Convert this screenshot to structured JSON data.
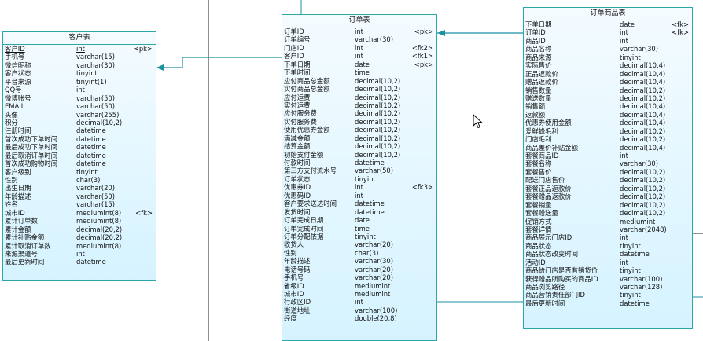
{
  "entities": {
    "customer": {
      "title": "客户表",
      "rows": [
        [
          "客户ID",
          "int",
          "<pk>"
        ],
        [
          "手机号",
          "varchar(15)",
          ""
        ],
        [
          "微信昵称",
          "varchar(30)",
          ""
        ],
        [
          "客户状态",
          "tinyint",
          ""
        ],
        [
          "平台来源",
          "tinyint(1)",
          ""
        ],
        [
          "QQ号",
          "int",
          ""
        ],
        [
          "微博账号",
          "varchar(50)",
          ""
        ],
        [
          "EMAIL",
          "varchar(50)",
          ""
        ],
        [
          "头像",
          "varchar(255)",
          ""
        ],
        [
          "积分",
          "decimal(10,2)",
          ""
        ],
        [
          "注册时间",
          "datetime",
          ""
        ],
        [
          "首次成功下单时间",
          "datetime",
          ""
        ],
        [
          "最后成功下单时间",
          "datetime",
          ""
        ],
        [
          "最后取消订单时间",
          "datetime",
          ""
        ],
        [
          "首次成功购物时间",
          "datetime",
          ""
        ],
        [
          "客户级别",
          "tinyint",
          ""
        ],
        [
          "性别",
          "char(3)",
          ""
        ],
        [
          "出生日期",
          "varchar(20)",
          ""
        ],
        [
          "年龄描述",
          "varchar(50)",
          ""
        ],
        [
          "姓名",
          "varchar(15)",
          ""
        ],
        [
          "城市ID",
          "mediumint(8)",
          "<fk>"
        ],
        [
          "累计订单数",
          "mediumint(8)",
          ""
        ],
        [
          "累计金额",
          "decimal(20,2)",
          ""
        ],
        [
          "累计补贴金额",
          "decimal(20,2)",
          ""
        ],
        [
          "累计取消订单数",
          "mediumint(8)",
          ""
        ],
        [
          "来源渠道号",
          "int",
          ""
        ],
        [
          "最后更新时间",
          "datetime",
          ""
        ]
      ]
    },
    "order": {
      "title": "订单表",
      "rows": [
        [
          "订单ID",
          "int",
          "<pk>"
        ],
        [
          "订单编号",
          "varchar(30)",
          ""
        ],
        [
          "门店ID",
          "int",
          "<fk2>"
        ],
        [
          "客户ID",
          "int",
          "<fk1>"
        ],
        [
          "下单日期",
          "date",
          "<pk>"
        ],
        [
          "下单时间",
          "time",
          ""
        ],
        [
          "应付商品总金额",
          "decimal(10,2)",
          ""
        ],
        [
          "实付商品总金额",
          "decimal(10,2)",
          ""
        ],
        [
          "应付运费",
          "decimal(10,2)",
          ""
        ],
        [
          "实付运费",
          "decimal(10,2)",
          ""
        ],
        [
          "应付服务费",
          "decimal(10,2)",
          ""
        ],
        [
          "实付服务费",
          "decimal(10,2)",
          ""
        ],
        [
          "使用优惠券金额",
          "decimal(10,2)",
          ""
        ],
        [
          "满减金额",
          "decimal(10,2)",
          ""
        ],
        [
          "结算金额",
          "decimal(10,2)",
          ""
        ],
        [
          "初始支付金额",
          "decimal(10,2)",
          ""
        ],
        [
          "付款时间",
          "datetime",
          ""
        ],
        [
          "第三方支付流水号",
          "varchar(50)",
          ""
        ],
        [
          "订单状态",
          "tinyint",
          ""
        ],
        [
          "优惠券ID",
          "int",
          "<fk3>"
        ],
        [
          "优惠码ID",
          "int",
          ""
        ],
        [
          "客户要求送达时间",
          "datetime",
          ""
        ],
        [
          "发货时间",
          "datetime",
          ""
        ],
        [
          "订单完成日期",
          "date",
          ""
        ],
        [
          "订单完成时间",
          "time",
          ""
        ],
        [
          "订单分配依据",
          "tinyint",
          ""
        ],
        [
          "收货人",
          "varchar(20)",
          ""
        ],
        [
          "性别",
          "char(3)",
          ""
        ],
        [
          "年龄描述",
          "varchar(30)",
          ""
        ],
        [
          "电话号码",
          "varchar(20)",
          ""
        ],
        [
          "手机号",
          "varchar(20)",
          ""
        ],
        [
          "省级ID",
          "mediumint",
          ""
        ],
        [
          "城市ID",
          "mediumint",
          ""
        ],
        [
          "行政区ID",
          "int",
          ""
        ],
        [
          "街道地址",
          "varchar(100)",
          ""
        ],
        [
          "经度",
          "double(20,8)",
          ""
        ]
      ]
    },
    "order_item": {
      "title": "订单商品表",
      "rows": [
        [
          "下单日期",
          "date",
          "<fk>"
        ],
        [
          "订单ID",
          "int",
          "<fk>"
        ],
        [
          "商品ID",
          "int",
          ""
        ],
        [
          "商品名称",
          "varchar(30)",
          ""
        ],
        [
          "商品来源",
          "tinyint",
          ""
        ],
        [
          "实际售价",
          "decimal(10,4)",
          ""
        ],
        [
          "正品返款价",
          "decimal(10,4)",
          ""
        ],
        [
          "赠品返款价",
          "decimal(10,4)",
          ""
        ],
        [
          "销售数量",
          "decimal(10,2)",
          ""
        ],
        [
          "赠送数量",
          "decimal(10,2)",
          ""
        ],
        [
          "销售额",
          "decimal(10,4)",
          ""
        ],
        [
          "返款额",
          "decimal(10,4)",
          ""
        ],
        [
          "优惠券使用金额",
          "decimal(10,4)",
          ""
        ],
        [
          "爱鲜蜂毛利",
          "decimal(10,2)",
          ""
        ],
        [
          "门店毛利",
          "decimal(10,2)",
          ""
        ],
        [
          "商品差价补贴金额",
          "decimal(10,4)",
          ""
        ],
        [
          "套餐商品ID",
          "int",
          ""
        ],
        [
          "套餐名称",
          "varchar(30)",
          ""
        ],
        [
          "套餐售价",
          "decimal(10,2)",
          ""
        ],
        [
          "配送门店售价",
          "decimal(10,2)",
          ""
        ],
        [
          "套餐正品返款价",
          "decimal(10,2)",
          ""
        ],
        [
          "套餐赠品返款价",
          "decimal(10,2)",
          ""
        ],
        [
          "套餐销量",
          "decimal(10,2)",
          ""
        ],
        [
          "套餐赠送量",
          "decimal(10,2)",
          ""
        ],
        [
          "促销方式",
          "mediumint",
          ""
        ],
        [
          "套餐详情",
          "varchar(2048)",
          ""
        ],
        [
          "商品展示门店ID",
          "int",
          ""
        ],
        [
          "商品状态",
          "tinyint",
          ""
        ],
        [
          "商品状态改变时间",
          "datetime",
          ""
        ],
        [
          "活动ID",
          "int",
          ""
        ],
        [
          "商品给门店是否有销货价",
          "tinyint",
          ""
        ],
        [
          "获得赠品所购买的商品ID",
          "varchar(100)",
          ""
        ],
        [
          "商品浏览路径",
          "varchar(128)",
          ""
        ],
        [
          "商品营销责任部门ID",
          "tinyint",
          ""
        ],
        [
          "最后更新时间",
          "datetime",
          ""
        ]
      ]
    }
  },
  "colors": {
    "accent": "#2aa7a6",
    "line": "#1b8fa5",
    "background": "#ffffff"
  },
  "icons": {
    "cursor": "mouse-pointer-icon"
  }
}
